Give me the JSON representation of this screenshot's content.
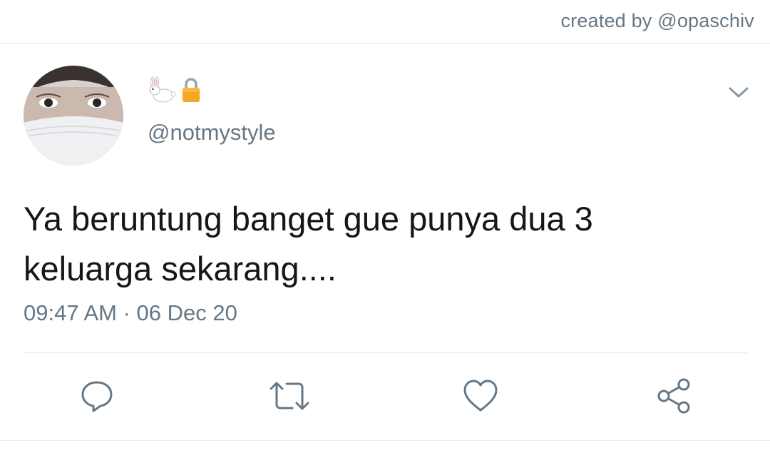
{
  "header": {
    "credit_text": "created by @opaschiv"
  },
  "user": {
    "display_name": "🐇🔒",
    "handle": "@notmystyle",
    "avatar_icon": "avatar-photo"
  },
  "tweet": {
    "text_line1": "Ya beruntung banget gue punya dua 3",
    "text_line2": "keluarga sekarang....",
    "timestamp": "09:47 AM · 06 Dec 20"
  },
  "actions": {
    "icons": [
      "reply-icon",
      "retweet-icon",
      "like-icon",
      "share-icon"
    ],
    "icon_color": "#657786"
  },
  "colors": {
    "text": "#14171a",
    "secondary": "#657786",
    "divider": "#e1e8ed"
  }
}
